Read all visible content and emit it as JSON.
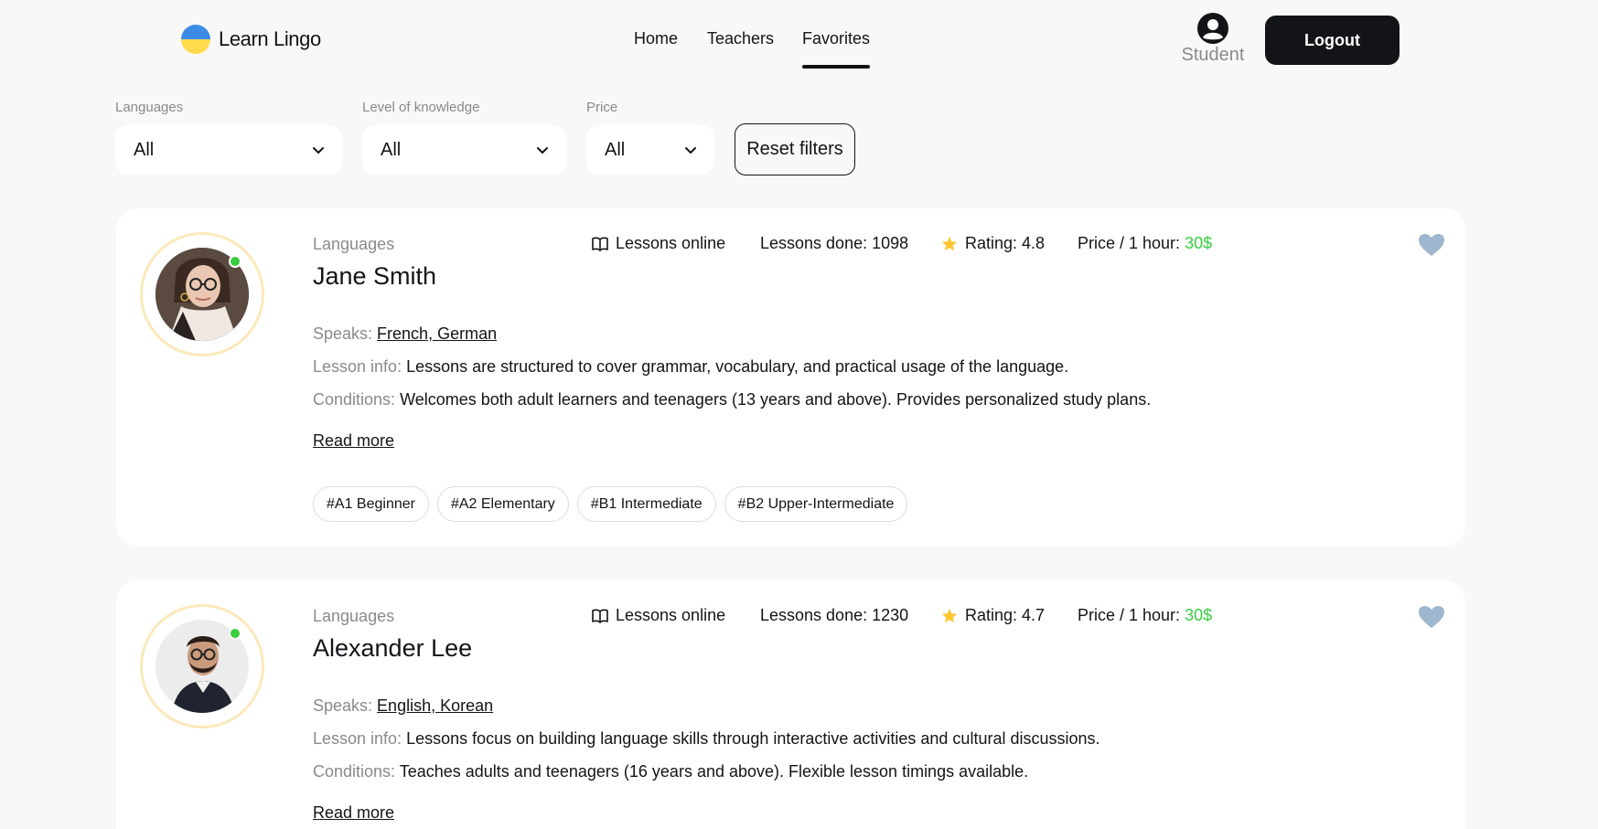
{
  "header": {
    "logo_text": "Learn Lingo",
    "nav": [
      "Home",
      "Teachers",
      "Favorites"
    ],
    "active_nav": "Favorites",
    "user_label": "Student",
    "logout_label": "Logout"
  },
  "filters": {
    "languages_label": "Languages",
    "languages_value": "All",
    "level_label": "Level of knowledge",
    "level_value": "All",
    "price_label": "Price",
    "price_value": "All",
    "reset_label": "Reset filters"
  },
  "labels": {
    "languages": "Languages",
    "lessons_online": "Lessons online",
    "lessons_done": "Lessons done: ",
    "rating": "Rating: ",
    "price": "Price / 1 hour: ",
    "speaks": "Speaks: ",
    "lesson_info": "Lesson info: ",
    "conditions": "Conditions: ",
    "read_more": "Read more"
  },
  "teachers": [
    {
      "name": "Jane Smith",
      "lessons_done": "1098",
      "rating": "4.8",
      "price": "30$",
      "speaks": "French, German",
      "lesson_info": "Lessons are structured to cover grammar, vocabulary, and practical usage of the language.",
      "conditions": "Welcomes both adult learners and teenagers (13 years and above). Provides personalized study plans.",
      "levels": [
        "#A1 Beginner",
        "#A2 Elementary",
        "#B1 Intermediate",
        "#B2 Upper-Intermediate"
      ]
    },
    {
      "name": "Alexander Lee",
      "lessons_done": "1230",
      "rating": "4.7",
      "price": "30$",
      "speaks": "English, Korean",
      "lesson_info": "Lessons focus on building language skills through interactive activities and cultural discussions.",
      "conditions": "Teaches adults and teenagers (16 years and above). Flexible lesson timings available."
    }
  ],
  "colors": {
    "accent_dark": "#121417",
    "price_green": "#38cd3e",
    "heart": "#9fb7ce",
    "star": "#ffc531",
    "avatar_ring": "#fbe9ba"
  }
}
